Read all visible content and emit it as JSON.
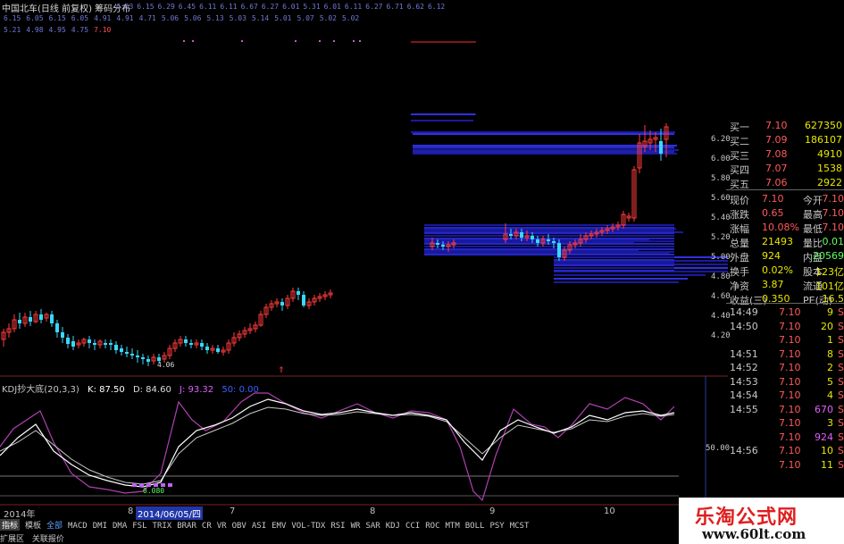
{
  "header": {
    "title": "中国北车(日线 前复权) 筹码分布",
    "price_row1": [
      "6.63",
      "6.15",
      "6.29",
      "6.45",
      "6.11",
      "6.11",
      "6.67",
      "6.27",
      "6.01",
      "5.31",
      "6.01",
      "6.11",
      "6.27",
      "6.71",
      "6.62",
      "6.12"
    ],
    "price_row2": [
      "6.15",
      "6.05",
      "6.15",
      "6.05",
      "4.91",
      "4.91",
      "4.71",
      "5.06",
      "5.06",
      "5.13",
      "5.03",
      "5.14",
      "5.01",
      "5.07",
      "5.02",
      "5.02"
    ],
    "price_row3": [
      "5.21",
      "4.98",
      "4.95",
      "4.75"
    ],
    "price_row3_last": "7.10"
  },
  "kdj": {
    "name": "KDJ抄大底(20,3,3)",
    "k": "K: 87.50",
    "d": "D: 84.60",
    "j": "J: 93.32",
    "extra": "50: 0.00",
    "level_label": "50.00",
    "low_label": "0.080",
    "low_price_label": "4.06"
  },
  "price_axis": [
    "6.20",
    "6.00",
    "5.80",
    "5.60",
    "5.40",
    "5.20",
    "5.00",
    "4.80",
    "4.60",
    "4.40",
    "4.20"
  ],
  "date_axis": {
    "year": "2014年",
    "m8": "8",
    "selected": "2014/06/05/四",
    "m7": "7",
    "m8b": "8",
    "m9": "9",
    "m10": "10"
  },
  "indicator_tabs": [
    {
      "label": "指标",
      "active": true
    },
    {
      "label": "模板",
      "active": false
    },
    {
      "label": "全部",
      "active": false,
      "blue": true
    },
    {
      "label": "MACD"
    },
    {
      "label": "DMI"
    },
    {
      "label": "DMA"
    },
    {
      "label": "FSL"
    },
    {
      "label": "TRIX"
    },
    {
      "label": "BRAR"
    },
    {
      "label": "CR"
    },
    {
      "label": "VR"
    },
    {
      "label": "OBV"
    },
    {
      "label": "ASI"
    },
    {
      "label": "EMV"
    },
    {
      "label": "VOL-TDX"
    },
    {
      "label": "RSI"
    },
    {
      "label": "WR"
    },
    {
      "label": "SAR"
    },
    {
      "label": "KDJ"
    },
    {
      "label": "CCI"
    },
    {
      "label": "ROC"
    },
    {
      "label": "MTM"
    },
    {
      "label": "BOLL"
    },
    {
      "label": "PSY"
    },
    {
      "label": "MCST"
    }
  ],
  "bottom_bar": [
    "扩展区",
    "关联报价"
  ],
  "quote": {
    "bids": [
      {
        "label": "买一",
        "price": "7.10",
        "vol": "627350"
      },
      {
        "label": "买二",
        "price": "7.09",
        "vol": "186107"
      },
      {
        "label": "买三",
        "price": "7.08",
        "vol": "4910"
      },
      {
        "label": "买四",
        "price": "7.07",
        "vol": "1538"
      },
      {
        "label": "买五",
        "price": "7.06",
        "vol": "2922"
      }
    ],
    "stats": [
      {
        "l1": "现价",
        "v1": "7.10",
        "l2": "今开",
        "v2": "7.10"
      },
      {
        "l1": "涨跌",
        "v1": "0.65",
        "l2": "最高",
        "v2": "7.10"
      },
      {
        "l1": "涨幅",
        "v1": "10.08%",
        "l2": "最低",
        "v2": "7.10"
      },
      {
        "l1": "总量",
        "v1": "21493",
        "l2": "量比",
        "v2": "0.01"
      },
      {
        "l1": "外盘",
        "v1": "924",
        "l2": "内盘",
        "v2": "20569"
      },
      {
        "l1": "换手",
        "v1": "0.02%",
        "l2": "股本",
        "v2": "123亿"
      },
      {
        "l1": "净资",
        "v1": "3.87",
        "l2": "流通",
        "v2": "101亿"
      },
      {
        "l1": "收益(三)",
        "v1": "0.350",
        "l2": "PE(动)",
        "v2": "16.5"
      }
    ],
    "ticks": [
      {
        "time": "14:49",
        "price": "7.10",
        "vol": "9",
        "side": "S"
      },
      {
        "time": "14:50",
        "price": "7.10",
        "vol": "20",
        "side": "S"
      },
      {
        "time": "",
        "price": "7.10",
        "vol": "1",
        "side": "S"
      },
      {
        "time": "14:51",
        "price": "7.10",
        "vol": "8",
        "side": "S"
      },
      {
        "time": "14:52",
        "price": "7.10",
        "vol": "2",
        "side": "S"
      },
      {
        "time": "14:53",
        "price": "7.10",
        "vol": "5",
        "side": "S"
      },
      {
        "time": "14:54",
        "price": "7.10",
        "vol": "4",
        "side": "S"
      },
      {
        "time": "14:55",
        "price": "7.10",
        "vol": "670",
        "side": "S",
        "mag": true
      },
      {
        "time": "",
        "price": "7.10",
        "vol": "3",
        "side": "S"
      },
      {
        "time": "",
        "price": "7.10",
        "vol": "924",
        "side": "S",
        "mag": true
      },
      {
        "time": "14:56",
        "price": "7.10",
        "vol": "10",
        "side": "S"
      },
      {
        "time": "",
        "price": "7.10",
        "vol": "11",
        "side": "S"
      }
    ]
  },
  "watermark": {
    "cn": "乐淘公式网",
    "url": "www.60lt.com"
  },
  "colors": {
    "up": "#ff3b3b",
    "down": "#38d8ff",
    "k": "#ffffff",
    "d": "#c8c8c8",
    "j": "#b040b0",
    "chip": "#1a1aa0",
    "chip_bright": "#3030e0"
  }
}
